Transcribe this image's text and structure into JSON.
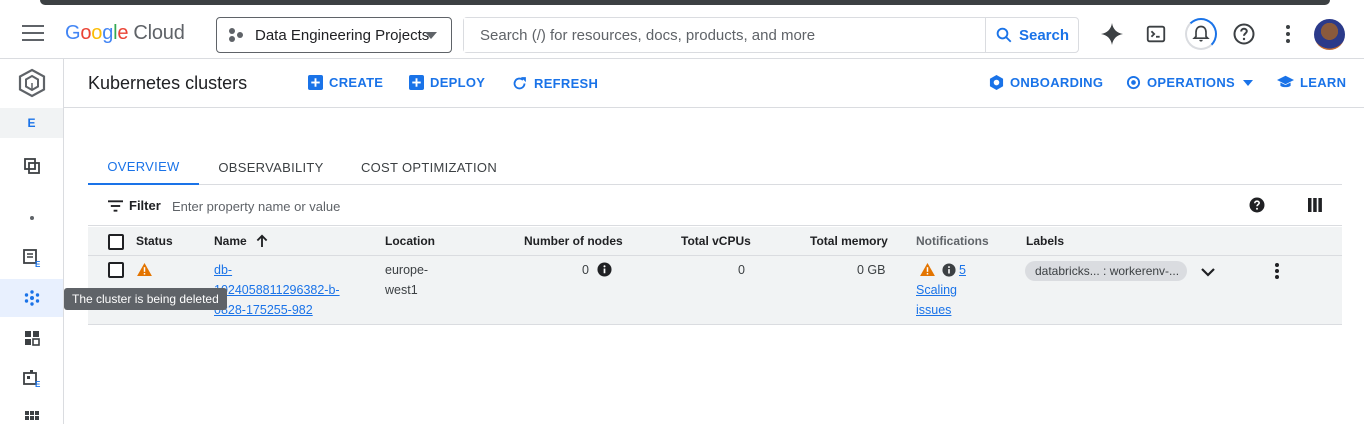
{
  "header": {
    "logo": {
      "g1": "G",
      "g2": "o",
      "g3": "o",
      "g4": "g",
      "g5": "l",
      "g6": "e",
      "cloud": "Cloud"
    },
    "project_name": "Data Engineering Projects",
    "search_placeholder": "Search (/) for resources, docs, products, and more",
    "search_button": "Search"
  },
  "leftnav": {
    "badge": "E"
  },
  "page": {
    "title": "Kubernetes clusters",
    "actions": {
      "create": "CREATE",
      "deploy": "DEPLOY",
      "refresh": "REFRESH",
      "onboarding": "ONBOARDING",
      "operations": "OPERATIONS",
      "learn": "LEARN"
    }
  },
  "tabs": [
    "OVERVIEW",
    "OBSERVABILITY",
    "COST OPTIMIZATION"
  ],
  "filter": {
    "label": "Filter",
    "placeholder": "Enter property name or value"
  },
  "table": {
    "columns": [
      "Status",
      "Name",
      "Location",
      "Number of nodes",
      "Total vCPUs",
      "Total memory",
      "Notifications",
      "Labels"
    ],
    "rows": [
      {
        "name_lines": [
          "db-",
          "1024058811296382-b-",
          "0828-175255-982"
        ],
        "location_lines": [
          "europe-",
          "west1"
        ],
        "nodes": "0",
        "vcpus": "0",
        "memory": "0 GB",
        "notif_count": "5",
        "notif_lines": [
          "Scaling",
          "issues"
        ],
        "label": "databricks... : workerenv-..."
      }
    ]
  },
  "tooltip": "The cluster is being deleted",
  "colors": {
    "accent": "#1a73e8",
    "warning": "#e37400"
  }
}
